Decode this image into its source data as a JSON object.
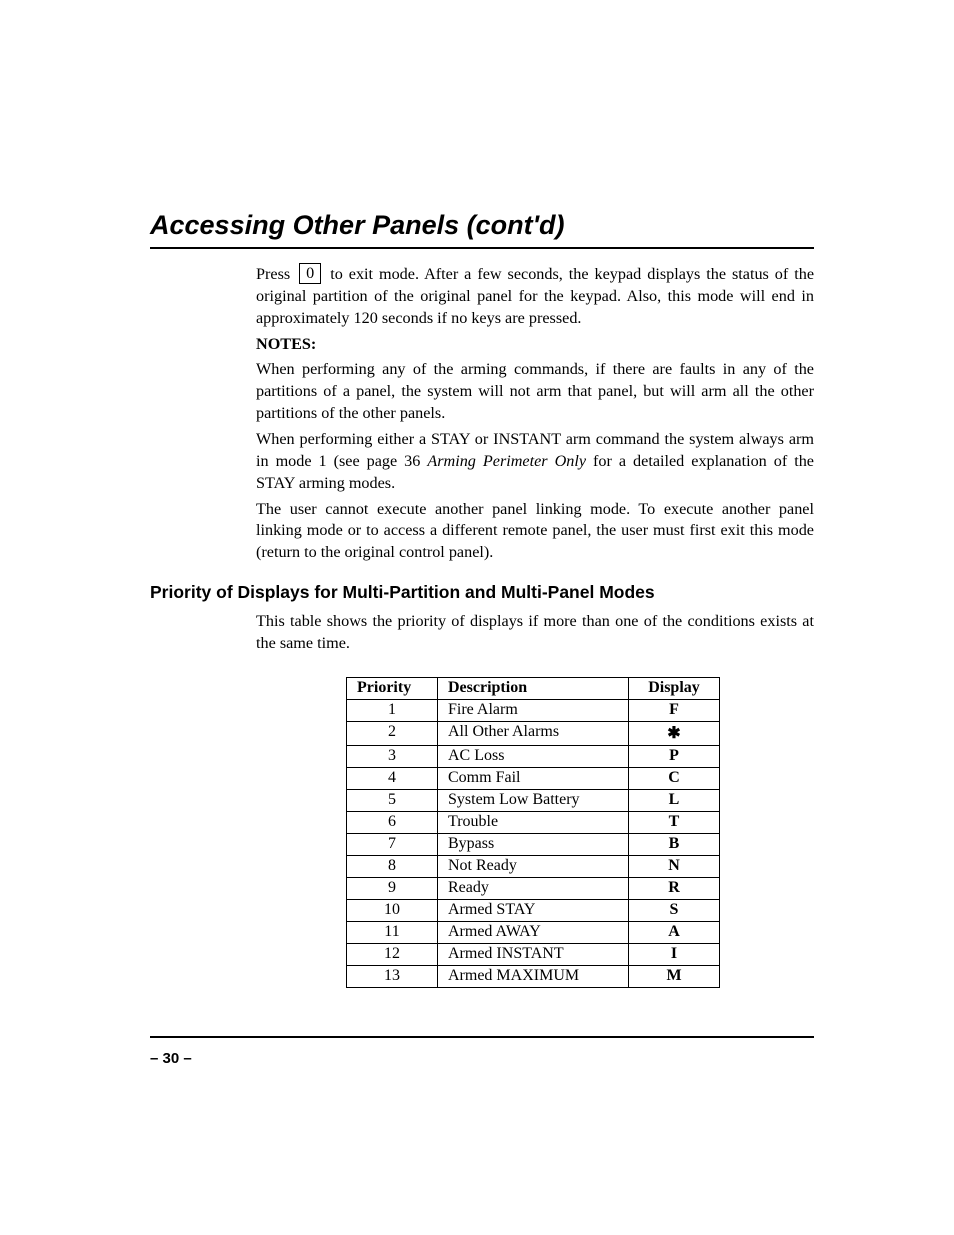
{
  "title": "Accessing Other Panels (cont'd)",
  "body": {
    "press_prefix": "Press",
    "keycap": "0",
    "press_suffix": " to exit mode. After a few seconds, the keypad displays the status of the original partition of the original panel for the keypad. Also, this mode will end in approximately 120 seconds if no keys are pressed.",
    "notes_label": "NOTES:",
    "note1": "When performing any of the arming commands, if there are faults in any of the partitions of a panel, the system will not arm that panel, but will arm all the other partitions of the other panels.",
    "note2_a": "When performing either a STAY or INSTANT arm command the system always arm in mode 1 (see page 36 ",
    "note2_ref": "Arming Perimeter Only",
    "note2_b": " for a detailed explanation of the STAY arming modes.",
    "note3": "The user cannot execute another panel linking mode. To execute another panel linking mode or to access a different remote panel, the user must first exit this mode (return to the original control panel)."
  },
  "subheading": "Priority of Displays for Multi-Partition and Multi-Panel Modes",
  "table_intro": "This table shows the priority of displays if more than one of the conditions exists at the same time.",
  "table": {
    "headers": {
      "priority": "Priority",
      "description": "Description",
      "display": "Display"
    },
    "rows": [
      {
        "priority": "1",
        "description": "Fire Alarm",
        "display": "F"
      },
      {
        "priority": "2",
        "description": "All Other Alarms",
        "display": "✱"
      },
      {
        "priority": "3",
        "description": "AC Loss",
        "display": "P"
      },
      {
        "priority": "4",
        "description": "Comm Fail",
        "display": "C"
      },
      {
        "priority": "5",
        "description": "System Low Battery",
        "display": "L"
      },
      {
        "priority": "6",
        "description": "Trouble",
        "display": "T"
      },
      {
        "priority": "7",
        "description": "Bypass",
        "display": "B"
      },
      {
        "priority": "8",
        "description": "Not Ready",
        "display": "N"
      },
      {
        "priority": "9",
        "description": "Ready",
        "display": "R"
      },
      {
        "priority": "10",
        "description": "Armed STAY",
        "display": "S"
      },
      {
        "priority": "11",
        "description": "Armed AWAY",
        "display": "A"
      },
      {
        "priority": "12",
        "description": "Armed INSTANT",
        "display": "I"
      },
      {
        "priority": "13",
        "description": "Armed MAXIMUM",
        "display": "M"
      }
    ]
  },
  "page_number": "– 30 –"
}
